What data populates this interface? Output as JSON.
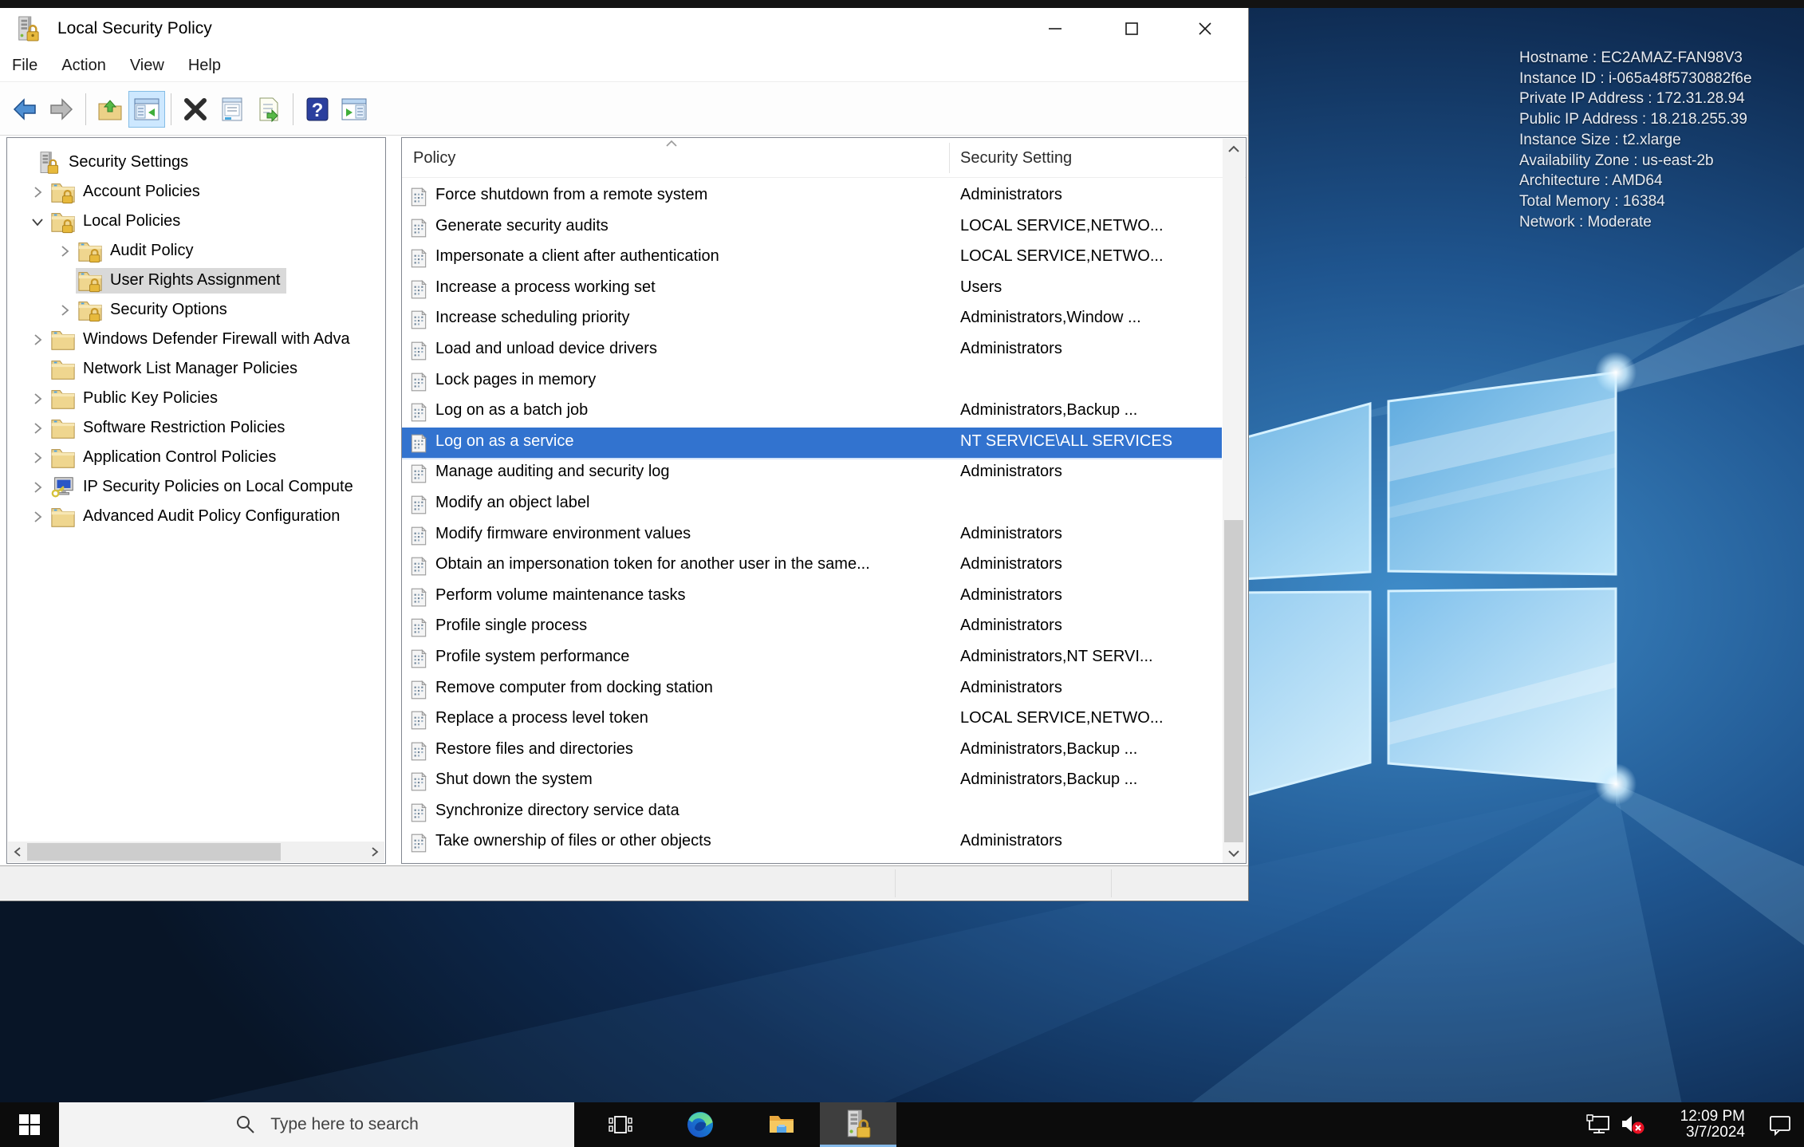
{
  "colors": {
    "selection": "#3273cf",
    "tree-selection": "#d9d9d9",
    "active-underline": "#85b9e8",
    "taskbar": "#0c0c0c"
  },
  "window": {
    "title": "Local Security Policy",
    "menu": {
      "items": [
        "File",
        "Action",
        "View",
        "Help"
      ]
    },
    "toolbar_icons": [
      "back",
      "forward",
      "export-folder",
      "show-console-tree",
      "delete",
      "properties",
      "export-list",
      "help",
      "show-action-pane"
    ],
    "tree": {
      "items": [
        {
          "label": "Security Settings",
          "level": 0,
          "icon": "root",
          "expand": "none",
          "selected": false
        },
        {
          "label": "Account Policies",
          "level": 1,
          "icon": "folder-lock",
          "expand": "collapsed",
          "selected": false
        },
        {
          "label": "Local Policies",
          "level": 1,
          "icon": "folder-lock",
          "expand": "expanded",
          "selected": false
        },
        {
          "label": "Audit Policy",
          "level": 2,
          "icon": "folder-lock",
          "expand": "collapsed",
          "selected": false
        },
        {
          "label": "User Rights Assignment",
          "level": 2,
          "icon": "folder-lock",
          "expand": "none",
          "selected": true
        },
        {
          "label": "Security Options",
          "level": 2,
          "icon": "folder-lock",
          "expand": "collapsed",
          "selected": false
        },
        {
          "label": "Windows Defender Firewall with Adva",
          "level": 1,
          "icon": "folder",
          "expand": "collapsed",
          "selected": false
        },
        {
          "label": "Network List Manager Policies",
          "level": 1,
          "icon": "folder",
          "expand": "none",
          "selected": false
        },
        {
          "label": "Public Key Policies",
          "level": 1,
          "icon": "folder",
          "expand": "collapsed",
          "selected": false
        },
        {
          "label": "Software Restriction Policies",
          "level": 1,
          "icon": "folder",
          "expand": "collapsed",
          "selected": false
        },
        {
          "label": "Application Control Policies",
          "level": 1,
          "icon": "folder",
          "expand": "collapsed",
          "selected": false
        },
        {
          "label": "IP Security Policies on Local Compute",
          "level": 1,
          "icon": "computer-key",
          "expand": "collapsed",
          "selected": false
        },
        {
          "label": "Advanced Audit Policy Configuration",
          "level": 1,
          "icon": "folder",
          "expand": "collapsed",
          "selected": false
        }
      ]
    },
    "list": {
      "columns": [
        "Policy",
        "Security Setting"
      ],
      "sort": "ascending",
      "rows": [
        {
          "policy": "Force shutdown from a remote system",
          "setting": "Administrators",
          "selected": false
        },
        {
          "policy": "Generate security audits",
          "setting": "LOCAL SERVICE,NETWO...",
          "selected": false
        },
        {
          "policy": "Impersonate a client after authentication",
          "setting": "LOCAL SERVICE,NETWO...",
          "selected": false
        },
        {
          "policy": "Increase a process working set",
          "setting": "Users",
          "selected": false
        },
        {
          "policy": "Increase scheduling priority",
          "setting": "Administrators,Window ...",
          "selected": false
        },
        {
          "policy": "Load and unload device drivers",
          "setting": "Administrators",
          "selected": false
        },
        {
          "policy": "Lock pages in memory",
          "setting": "",
          "selected": false
        },
        {
          "policy": "Log on as a batch job",
          "setting": "Administrators,Backup ...",
          "selected": false
        },
        {
          "policy": "Log on as a service",
          "setting": "NT SERVICE\\ALL SERVICES",
          "selected": true
        },
        {
          "policy": "Manage auditing and security log",
          "setting": "Administrators",
          "selected": false
        },
        {
          "policy": "Modify an object label",
          "setting": "",
          "selected": false
        },
        {
          "policy": "Modify firmware environment values",
          "setting": "Administrators",
          "selected": false
        },
        {
          "policy": "Obtain an impersonation token for another user in the same...",
          "setting": "Administrators",
          "selected": false
        },
        {
          "policy": "Perform volume maintenance tasks",
          "setting": "Administrators",
          "selected": false
        },
        {
          "policy": "Profile single process",
          "setting": "Administrators",
          "selected": false
        },
        {
          "policy": "Profile system performance",
          "setting": "Administrators,NT SERVI...",
          "selected": false
        },
        {
          "policy": "Remove computer from docking station",
          "setting": "Administrators",
          "selected": false
        },
        {
          "policy": "Replace a process level token",
          "setting": "LOCAL SERVICE,NETWO...",
          "selected": false
        },
        {
          "policy": "Restore files and directories",
          "setting": "Administrators,Backup ...",
          "selected": false
        },
        {
          "policy": "Shut down the system",
          "setting": "Administrators,Backup ...",
          "selected": false
        },
        {
          "policy": "Synchronize directory service data",
          "setting": "",
          "selected": false
        },
        {
          "policy": "Take ownership of files or other objects",
          "setting": "Administrators",
          "selected": false
        }
      ]
    }
  },
  "desktop": {
    "instance_info": [
      "Hostname : EC2AMAZ-FAN98V3",
      "Instance ID : i-065a48f5730882f6e",
      "Private IP Address : 172.31.28.94",
      "Public IP Address : 18.218.255.39",
      "Instance Size : t2.xlarge",
      "Availability Zone : us-east-2b",
      "Architecture : AMD64",
      "Total Memory : 16384",
      "Network : Moderate"
    ]
  },
  "taskbar": {
    "search": {
      "placeholder": "Type here to search"
    },
    "app_icons": [
      "start",
      "task-view",
      "edge",
      "file-explorer",
      "local-security-policy"
    ],
    "tray": {
      "icons": [
        "network",
        "volume-muted",
        "action-center"
      ],
      "time": "12:09 PM",
      "date": "3/7/2024"
    }
  }
}
